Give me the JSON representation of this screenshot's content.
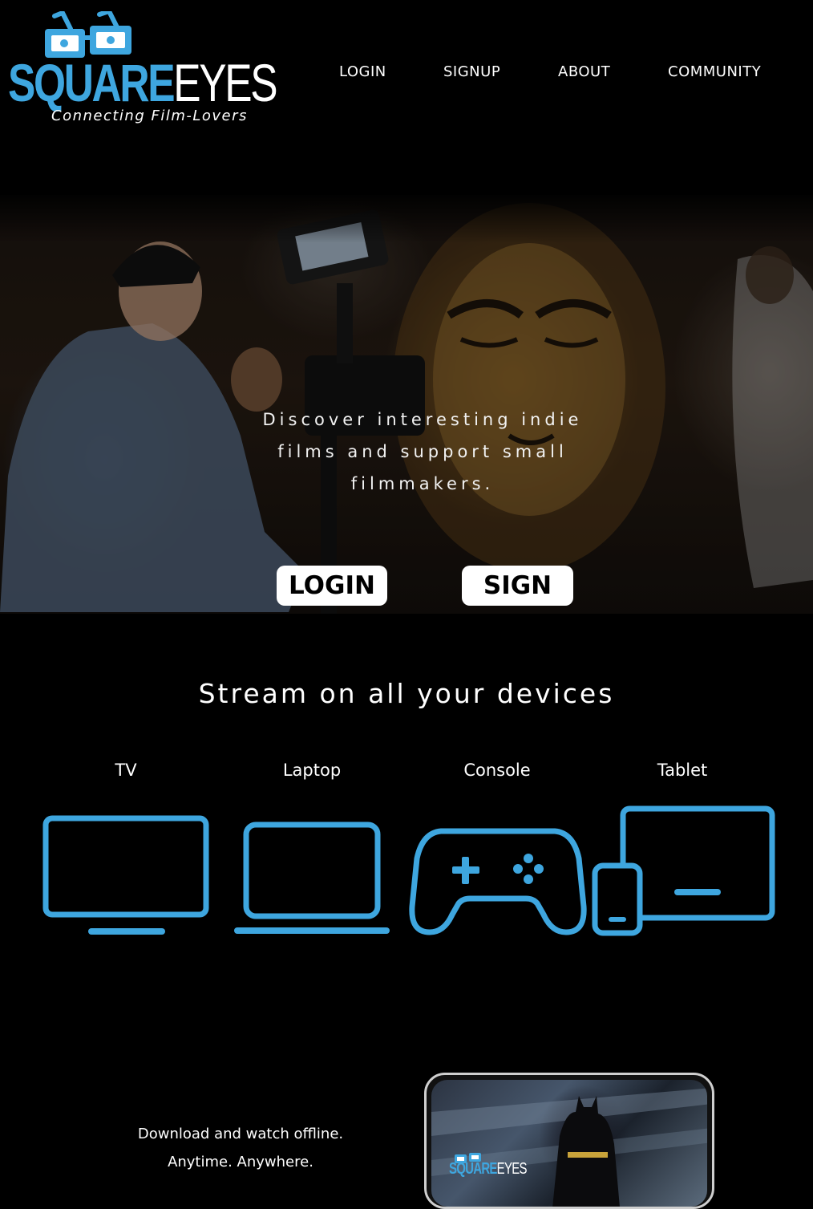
{
  "brand": {
    "name_part1": "SQUARE",
    "name_part2": "EYES",
    "tagline": "Connecting Film-Lovers",
    "accent_color": "#3ea6df"
  },
  "nav": {
    "items": [
      {
        "label": "LOGIN"
      },
      {
        "label": "SIGNUP"
      },
      {
        "label": "ABOUT"
      },
      {
        "label": "COMMUNITY"
      }
    ]
  },
  "hero": {
    "tagline": "Discover interesting indie films and support small filmmakers.",
    "login_label": "LOGIN",
    "signup_label": "SIGN UP"
  },
  "devices": {
    "title": "Stream on all your devices",
    "items": [
      {
        "label": "TV",
        "icon": "tv-icon"
      },
      {
        "label": "Laptop",
        "icon": "laptop-icon"
      },
      {
        "label": "Console",
        "icon": "gamepad-icon"
      },
      {
        "label": "Tablet",
        "icon": "tablet-phone-icon"
      }
    ]
  },
  "download": {
    "line1": "Download and watch offline.",
    "line2": "Anytime. Anywhere."
  },
  "phone_preview": {
    "logo_part1": "SQUARE",
    "logo_part2": "EYES"
  }
}
